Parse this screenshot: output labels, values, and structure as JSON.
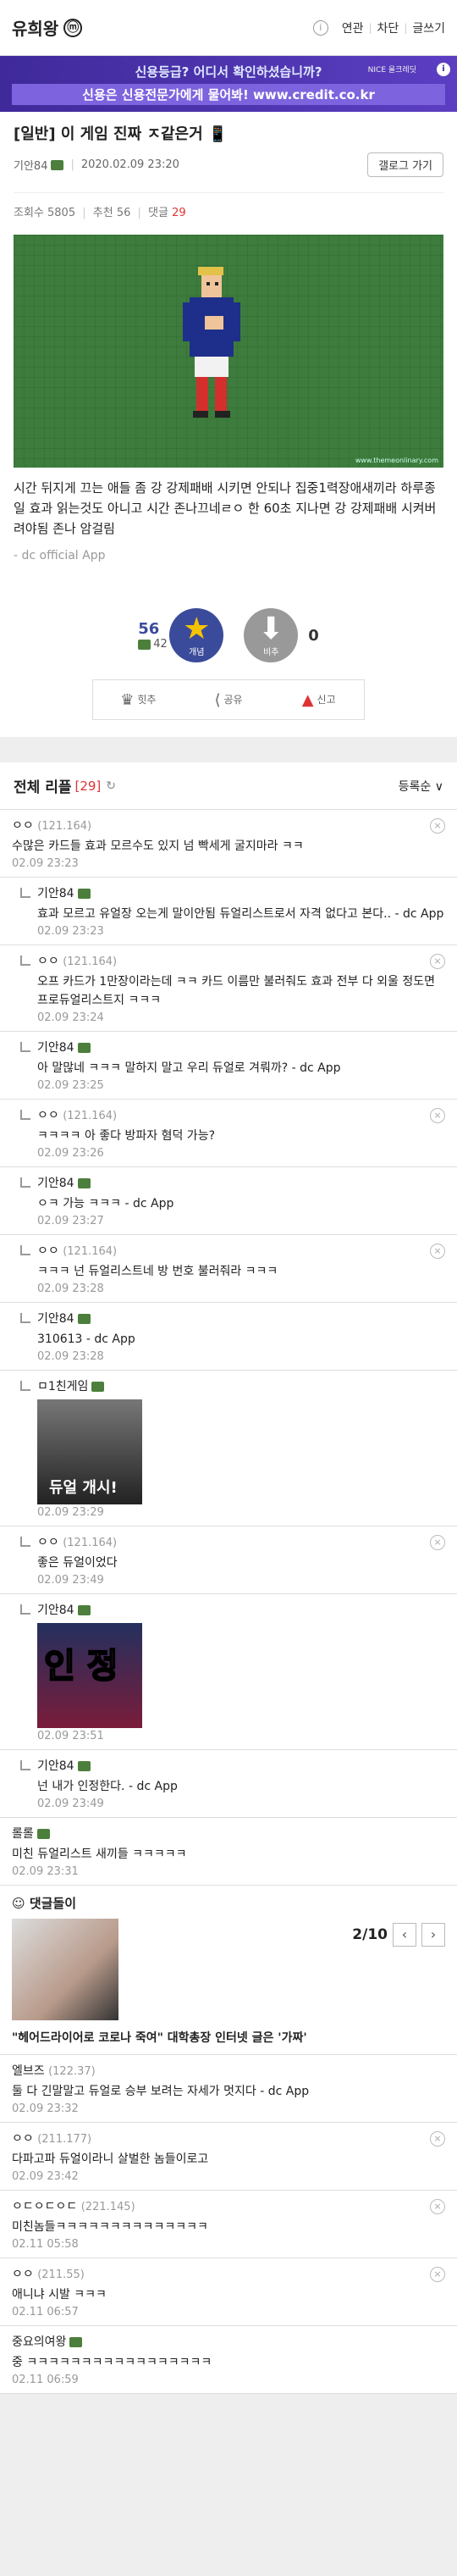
{
  "header": {
    "gallery_title": "유희왕",
    "badge": "ⓜ",
    "links": [
      "연관",
      "차단",
      "글쓰기"
    ]
  },
  "ad": {
    "line1": "신용등급? 어디서 확인하셨습니까?",
    "line2": "신용은 신용전문가에게 물어봐! www.credit.co.kr",
    "brand": "NICE 올크레딧"
  },
  "post": {
    "title": "[일반] 이 게임 진짜 ㅈ같은거 📱",
    "author": "기안84",
    "date": "2020.02.09 23:20",
    "list_button": "갤로그 가기",
    "views": "조회수 5805",
    "recommend": "추천 56",
    "comments_label": "댓글",
    "comments_count": "29",
    "image_credit": "www.themeonlinary.com",
    "body": "시간 뒤지게 끄는 애들 좀 강 강제패배 시키면 안되나 집중1력장애새끼라 하루종일 효과 읽는것도 아니고 시간 존나끄네ㄹㅇ 한 60초 지나면 강 강제패배 시켜버려야됨 존나 암걸림",
    "source": "- dc official App"
  },
  "votes": {
    "up": "56",
    "up_sub": "42",
    "up_label": "개념",
    "down": "0",
    "down_label": "비추"
  },
  "actions": {
    "a1": "힛추",
    "a2": "공유",
    "a3": "신고"
  },
  "comments_header": {
    "title": "전체 리플",
    "count": "[29]",
    "sort": "등록순 ∨"
  },
  "comments": [
    {
      "nick": "ㅇㅇ",
      "ip": "(121.164)",
      "text": "수많은 카드들 효과 모르수도 있지 넘 빡세게 굴지마라 ㅋㅋ",
      "date": "02.09 23:23"
    },
    {
      "nick": "기안84",
      "text": "효과 모르고 유얼장 오는게 말이안됨 듀얼리스트로서 자격 없다고 본다.. - dc App",
      "date": "02.09 23:23"
    },
    {
      "nick": "ㅇㅇ",
      "ip": "(121.164)",
      "text": "오프 카드가 1만장이라는데 ㅋㅋ 카드 이름만 불러줘도 효과 전부 다 외울 정도면 프로듀얼리스트지 ㅋㅋㅋ",
      "date": "02.09 23:24"
    },
    {
      "nick": "기안84",
      "text": "아 말많네 ㅋㅋㅋ 말하지 말고 우리 듀얼로 겨뤄까? - dc App",
      "date": "02.09 23:25"
    },
    {
      "nick": "ㅇㅇ",
      "ip": "(121.164)",
      "text": "ㅋㅋㅋㅋ 아 좋다 방파자 혐덕 가능?",
      "date": "02.09 23:26"
    },
    {
      "nick": "기안84",
      "text": "ㅇㅋ 가능 ㅋㅋㅋ - dc App",
      "date": "02.09 23:27"
    },
    {
      "nick": "ㅇㅇ",
      "ip": "(121.164)",
      "text": "ㅋㅋㅋ 넌 듀얼리스트네 방 번호 불러줘라 ㅋㅋㅋ",
      "date": "02.09 23:28"
    },
    {
      "nick": "기안84",
      "text": "310613 - dc App",
      "date": "02.09 23:28"
    },
    {
      "nick": "ㅁ1친게임",
      "img_text": "듀얼 개시!",
      "date": "02.09 23:29"
    },
    {
      "nick": "ㅇㅇ",
      "ip": "(121.164)",
      "text": "좋은 듀얼이었다",
      "date": "02.09 23:49"
    },
    {
      "nick": "기안84",
      "img_text": "인 정",
      "date": "02.09 23:51"
    },
    {
      "nick": "기안84",
      "text": "넌 내가 인정한다. - dc App",
      "date": "02.09 23:49"
    },
    {
      "nick": "롤롤",
      "text": "미친 듀얼리스트 새끼들 ㅋㅋㅋㅋㅋ",
      "date": "02.09 23:31"
    },
    {
      "nick": "엘브즈",
      "ip": "(122.37)",
      "text": "둘 다 긴말말고 듀얼로 승부 보려는 자세가 멋지다 - dc App",
      "date": "02.09 23:32"
    },
    {
      "nick": "ㅇㅇ",
      "ip": "(211.177)",
      "text": "다파고파 듀얼이라니 살벌한 놈들이로고",
      "date": "02.09 23:42"
    },
    {
      "nick": "ㅇㄷㅇㄷㅇㄷ",
      "ip": "(221.145)",
      "text": "미친놈들ㅋㅋㅋㅋㅋㅋㅋㅋㅋㅋㅋㅋㅋㅋ",
      "date": "02.11 05:58"
    },
    {
      "nick": "ㅇㅇ",
      "ip": "(211.55)",
      "text": "애니냐 시발 ㅋㅋㅋ",
      "date": "02.11 06:57"
    },
    {
      "nick": "중요의여왕",
      "text": "중 ㅋㅋㅋㅋㅋㅋㅋㅋㅋㅋㅋㅋㅋㅋㅋㅋㅋ",
      "date": "02.11 06:59"
    }
  ],
  "dcbot": {
    "head": "댓글돌이",
    "page": "2/10",
    "caption": "\"헤어드라이어로 코로나 죽여\" 대학총장 인터넷 글은 '가짜'"
  }
}
